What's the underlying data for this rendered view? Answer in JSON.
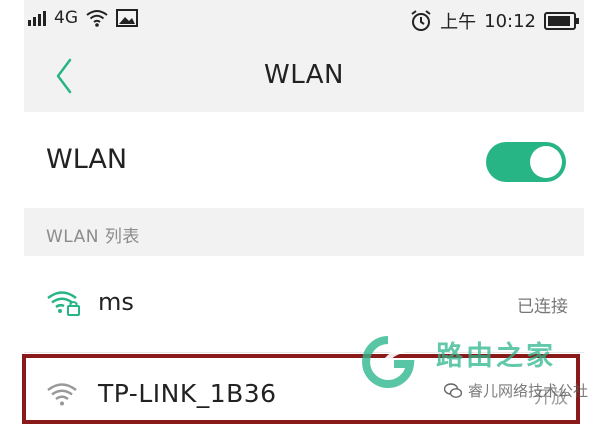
{
  "status_bar": {
    "network": "4G",
    "am_pm": "上午",
    "time": "10:12"
  },
  "header": {
    "title": "WLAN"
  },
  "wlan_toggle": {
    "label": "WLAN",
    "state": "on"
  },
  "section": {
    "label": "WLAN 列表"
  },
  "networks": [
    {
      "name": "ms",
      "status": "已连接",
      "secured": true
    },
    {
      "name": "TP-LINK_1B36",
      "status": "开放",
      "secured": false
    }
  ],
  "watermark": {
    "title": "路由之家",
    "subtitle": "睿儿网络技术公社"
  },
  "colors": {
    "accent": "#27b585",
    "highlight": "#8a1a1a",
    "background": "#f2f2f2"
  }
}
